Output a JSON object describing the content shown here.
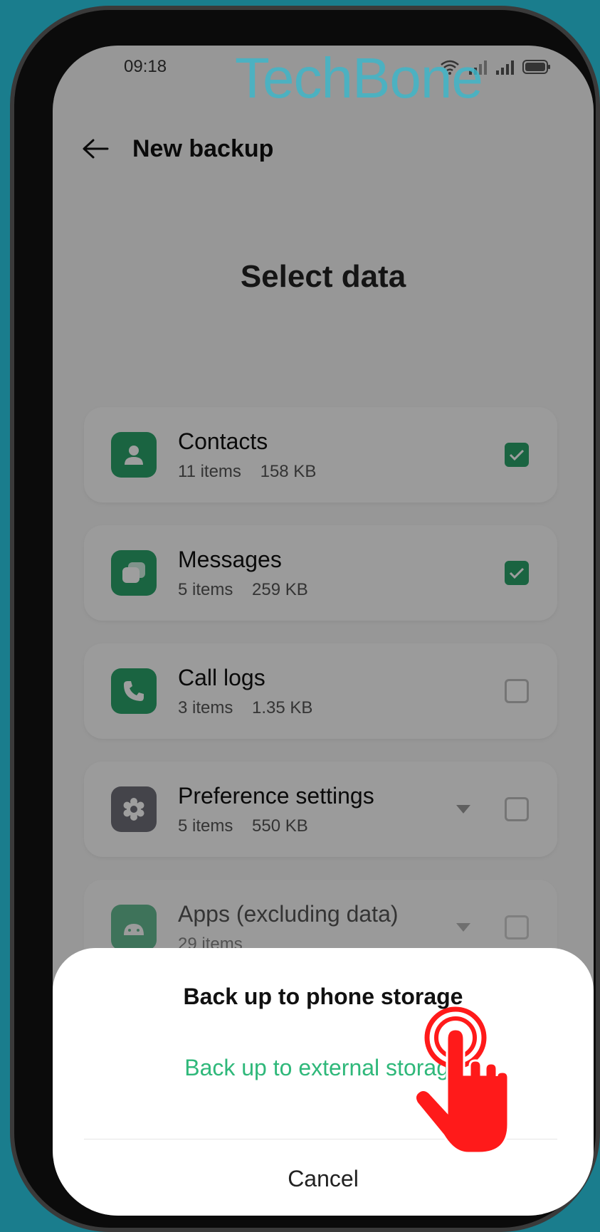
{
  "status_bar": {
    "time": "09:18"
  },
  "watermark": "TechBone",
  "header": {
    "title": "New backup"
  },
  "section_title": "Select data",
  "items": [
    {
      "label": "Contacts",
      "count": "11 items",
      "size": "158 KB",
      "checked": true,
      "has_dropdown": false,
      "icon": "contact-icon",
      "icon_color": "#2aa26a"
    },
    {
      "label": "Messages",
      "count": "5 items",
      "size": "259 KB",
      "checked": true,
      "has_dropdown": false,
      "icon": "messages-icon",
      "icon_color": "#2aa26a"
    },
    {
      "label": "Call logs",
      "count": "3 items",
      "size": "1.35 KB",
      "checked": false,
      "has_dropdown": false,
      "icon": "phone-icon",
      "icon_color": "#2aa26a"
    },
    {
      "label": "Preference settings",
      "count": "5 items",
      "size": "550 KB",
      "checked": false,
      "has_dropdown": true,
      "icon": "gear-icon",
      "icon_color": "#6f6f78"
    },
    {
      "label": "Apps (excluding data)",
      "count": "29 items",
      "size": "",
      "checked": false,
      "has_dropdown": true,
      "icon": "android-icon",
      "icon_color": "#2aa26a"
    }
  ],
  "sheet": {
    "phone_storage": "Back up to phone storage",
    "external_storage": "Back up to external storage",
    "cancel": "Cancel"
  },
  "colors": {
    "background": "#1a7d8d",
    "accent_green": "#2fb87a",
    "checkbox_green": "#2aa26a",
    "tap_red": "#ff1a1a"
  }
}
